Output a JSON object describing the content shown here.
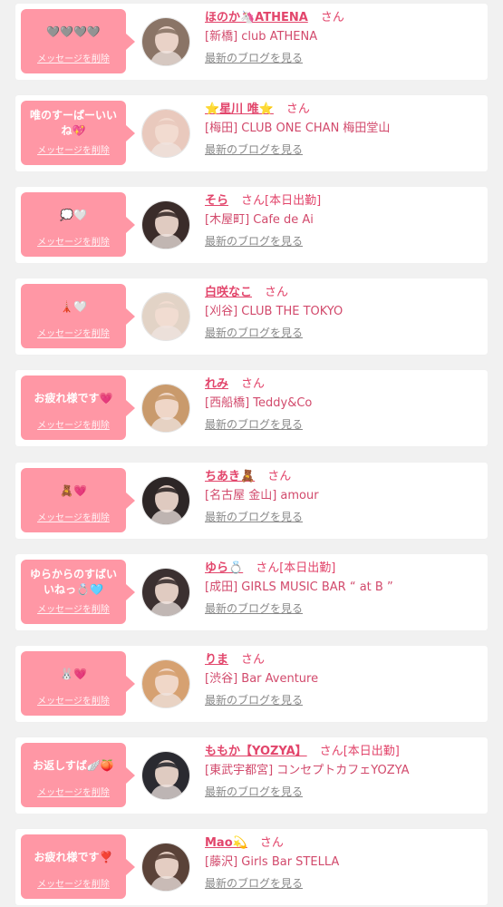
{
  "common": {
    "delete_label": "メッセージを削除",
    "blog_label": "最新のブログを見る",
    "san_label": "さん"
  },
  "items": [
    {
      "message": "🩶🩶🩶🩶",
      "name": "ほのか🦄ATHENA",
      "status": "",
      "shop": "[新橋] club ATHENA",
      "avatar_color": "#8a7466"
    },
    {
      "message": "唯のすーぱーいいね💖",
      "name": "⭐️星川 唯⭐️",
      "status": "",
      "shop": "[梅田] CLUB ONE CHAN 梅田堂山",
      "avatar_color": "#e9c9bd"
    },
    {
      "message": "💭🤍",
      "name": "そら",
      "status": "[本日出勤]",
      "shop": "[木屋町] Cafe de Ai",
      "avatar_color": "#3a2c2a"
    },
    {
      "message": "🗼🤍",
      "name": "白咲なこ",
      "status": "",
      "shop": "[刈谷] CLUB THE TOKYO",
      "avatar_color": "#e2d3c6"
    },
    {
      "message": "お疲れ様です💗",
      "name": "れみ",
      "status": "",
      "shop": "[西船橋] Teddy&Co",
      "avatar_color": "#c99a6c"
    },
    {
      "message": "🧸💗",
      "name": "ちあき🧸",
      "status": "",
      "shop": "[名古屋 金山] amour",
      "avatar_color": "#2d2626"
    },
    {
      "message": "ゆらからのすばいいねっ💍🩵",
      "name": "ゆら💍",
      "status": "[本日出勤]",
      "shop": "[成田] GIRLS MUSIC BAR “ at B ”",
      "avatar_color": "#3b3030"
    },
    {
      "message": "🐰💗",
      "name": "りま",
      "status": "",
      "shop": "[渋谷] Bar Aventure",
      "avatar_color": "#d6a171"
    },
    {
      "message": "お返しすば🪽🍑",
      "name": "ももか【YOZYA】",
      "status": "[本日出勤]",
      "shop": "[東武宇都宮] コンセプトカフェYOZYA",
      "avatar_color": "#2a2a30"
    },
    {
      "message": "お疲れ様です❣️",
      "name": "Mao💫",
      "status": "",
      "shop": "[藤沢] Girls Bar STELLA",
      "avatar_color": "#5a4238"
    }
  ]
}
